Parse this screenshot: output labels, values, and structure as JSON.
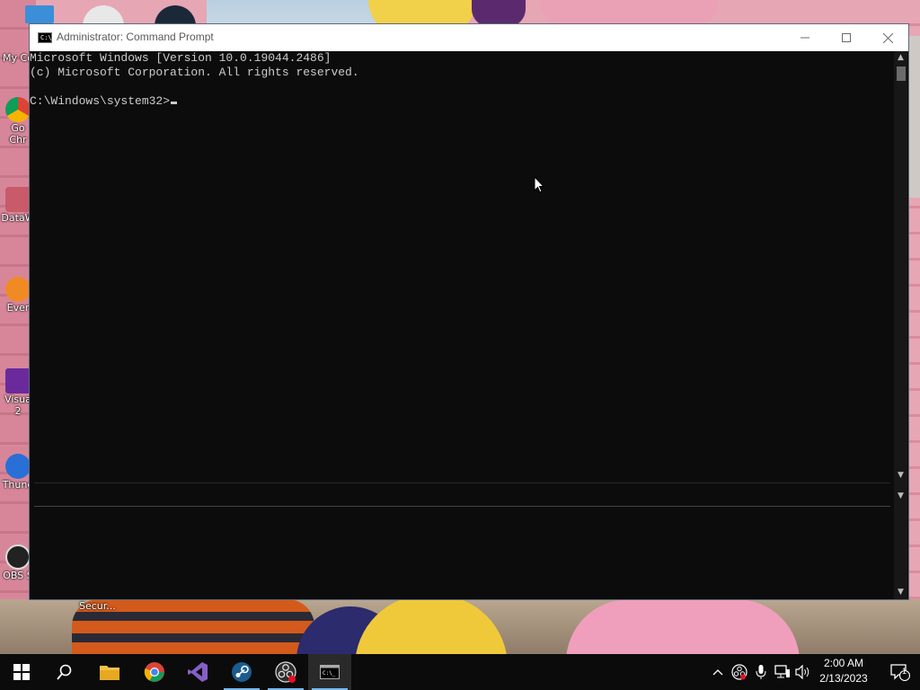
{
  "window": {
    "title": "Administrator:  Command Prompt",
    "icon_text": "C:\\"
  },
  "console": {
    "lines": [
      "Microsoft Windows [Version 10.0.19044.2486]",
      "(c) Microsoft Corporation. All rights reserved.",
      "",
      "C:\\Windows\\system32>"
    ]
  },
  "desktop": {
    "icons": [
      {
        "label": "My Co"
      },
      {
        "label": "Go"
      },
      {
        "label": "Chr"
      },
      {
        "label": "DataW"
      },
      {
        "label": "Ever"
      },
      {
        "label": "Visua"
      },
      {
        "label": "2"
      },
      {
        "label": "Thund"
      },
      {
        "label": "OBS S"
      }
    ],
    "extra_label": "Secur..."
  },
  "taskbar": {
    "items": [
      {
        "name": "start",
        "icon": "windows-logo-icon"
      },
      {
        "name": "search",
        "icon": "search-icon"
      },
      {
        "name": "file-explorer",
        "icon": "folder-icon"
      },
      {
        "name": "chrome",
        "icon": "chrome-icon"
      },
      {
        "name": "visual-studio",
        "icon": "visual-studio-icon"
      },
      {
        "name": "steam",
        "icon": "steam-icon"
      },
      {
        "name": "obs",
        "icon": "obs-icon"
      },
      {
        "name": "command-prompt",
        "icon": "cmd-icon"
      }
    ],
    "clock": {
      "time": "2:00 AM",
      "date": "2/13/2023"
    },
    "notification_count": "1"
  },
  "colors": {
    "console_bg": "#0c0c0c",
    "console_fg": "#cccccc",
    "taskbar_bg": "#0b0b0b",
    "accent": "#76b9ed"
  }
}
